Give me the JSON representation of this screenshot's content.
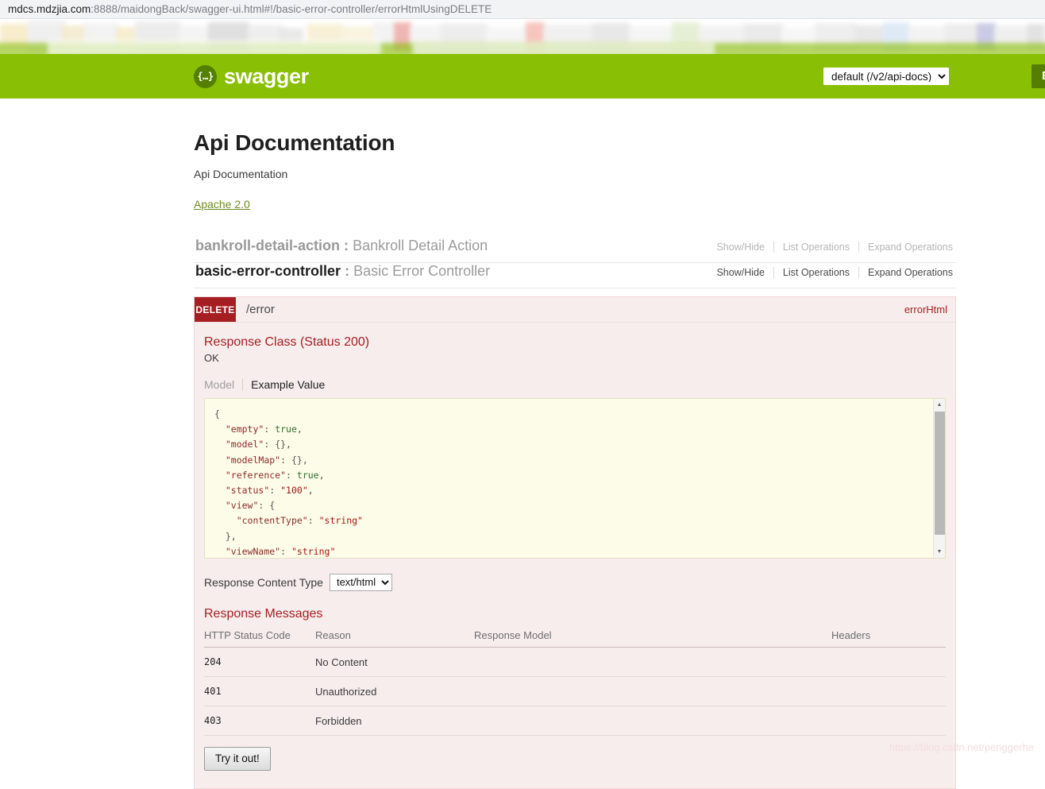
{
  "browser": {
    "url_host": "mdcs.mdzjia.com",
    "url_rest": ":8888/maidongBack/swagger-ui.html#!/basic-error-controller/errorHtmlUsingDELETE"
  },
  "header": {
    "logo_glyph": "{…}",
    "logo_text": "swagger",
    "api_select_value": "default (/v2/api-docs)",
    "explore_label": "Explore",
    "brand_green": "#89bf04",
    "brand_dark_green": "#547f00"
  },
  "info": {
    "title": "Api Documentation",
    "description": "Api Documentation",
    "license_label": "Apache 2.0"
  },
  "resources": [
    {
      "name": "bankroll-detail-action",
      "separator": ":",
      "description": "Bankroll Detail Action",
      "active": false,
      "options": [
        "Show/Hide",
        "List Operations",
        "Expand Operations"
      ]
    },
    {
      "name": "basic-error-controller",
      "separator": ":",
      "description": "Basic Error Controller",
      "active": true,
      "options": [
        "Show/Hide",
        "List Operations",
        "Expand Operations"
      ]
    }
  ],
  "operation": {
    "method": "DELETE",
    "method_color": "#a41e22",
    "path": "/error",
    "nickname": "errorHtml",
    "response_class_title": "Response Class (Status 200)",
    "response_class_note": "OK",
    "tabs": [
      {
        "label": "Model",
        "active": false
      },
      {
        "label": "Example Value",
        "active": true
      }
    ],
    "example_value": {
      "lines": [
        {
          "indent": 0,
          "text": "{",
          "type": "punc"
        },
        {
          "indent": 1,
          "key": "\"empty\"",
          "value": "true",
          "value_type": "bool",
          "comma": true
        },
        {
          "indent": 1,
          "key": "\"model\"",
          "value": "{}",
          "value_type": "punc",
          "comma": true
        },
        {
          "indent": 1,
          "key": "\"modelMap\"",
          "value": "{}",
          "value_type": "punc",
          "comma": true
        },
        {
          "indent": 1,
          "key": "\"reference\"",
          "value": "true",
          "value_type": "bool",
          "comma": true
        },
        {
          "indent": 1,
          "key": "\"status\"",
          "value": "\"100\"",
          "value_type": "str",
          "comma": true
        },
        {
          "indent": 1,
          "key": "\"view\"",
          "value": "{",
          "value_type": "punc",
          "comma": false
        },
        {
          "indent": 2,
          "key": "\"contentType\"",
          "value": "\"string\"",
          "value_type": "str",
          "comma": false
        },
        {
          "indent": 1,
          "text": "},",
          "type": "punc"
        },
        {
          "indent": 1,
          "key": "\"viewName\"",
          "value": "\"string\"",
          "value_type": "str",
          "comma": false
        },
        {
          "indent": 0,
          "text": "}",
          "type": "punc"
        }
      ],
      "raw": "{\n  \"empty\": true,\n  \"model\": {},\n  \"modelMap\": {},\n  \"reference\": true,\n  \"status\": \"100\",\n  \"view\": {\n    \"contentType\": \"string\"\n  },\n  \"viewName\": \"string\"\n}"
    },
    "response_content_type_label": "Response Content Type",
    "response_content_type_value": "text/html",
    "response_messages_title": "Response Messages",
    "table": {
      "headers": [
        "HTTP Status Code",
        "Reason",
        "Response Model",
        "Headers"
      ],
      "rows": [
        {
          "status": "204",
          "reason": "No Content",
          "model": "",
          "headers": ""
        },
        {
          "status": "401",
          "reason": "Unauthorized",
          "model": "",
          "headers": ""
        },
        {
          "status": "403",
          "reason": "Forbidden",
          "model": "",
          "headers": ""
        }
      ]
    },
    "try_it_out_label": "Try it out!"
  },
  "watermark": "https://blog.csdn.net/penggerhe",
  "scrollbar": {
    "up_glyph": "▲",
    "down_glyph": "▼"
  }
}
